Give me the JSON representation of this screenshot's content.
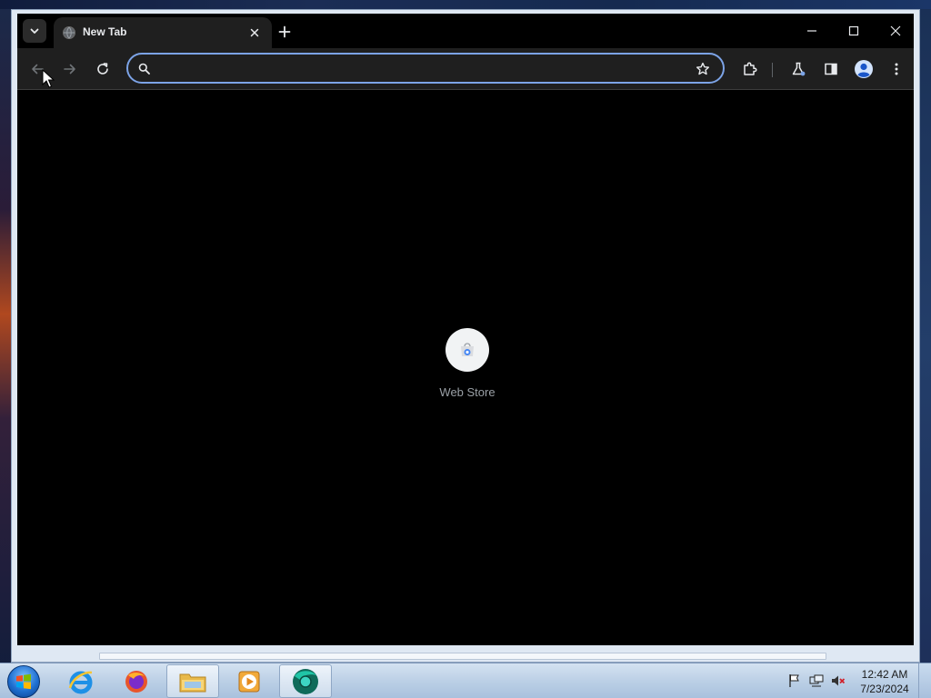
{
  "browser": {
    "tab": {
      "title": "New Tab",
      "favicon": "globe-icon"
    },
    "omnibox": {
      "value": "",
      "placeholder": ""
    },
    "shortcuts": [
      {
        "label": "Web Store",
        "icon": "web-store-icon"
      }
    ]
  },
  "taskbar": {
    "apps": [
      {
        "name": "internet-explorer",
        "icon": "internet-explorer-icon"
      },
      {
        "name": "firefox",
        "icon": "firefox-icon"
      },
      {
        "name": "file-explorer",
        "icon": "folder-icon"
      },
      {
        "name": "media-player",
        "icon": "media-player-icon"
      },
      {
        "name": "chrome",
        "icon": "chrome-icon",
        "active": true
      }
    ],
    "clock": {
      "time": "12:42 AM",
      "date": "7/23/2024"
    }
  },
  "colors": {
    "accent": "#7ca3e6",
    "toolbar": "#1f1f1f",
    "content": "#000000"
  }
}
